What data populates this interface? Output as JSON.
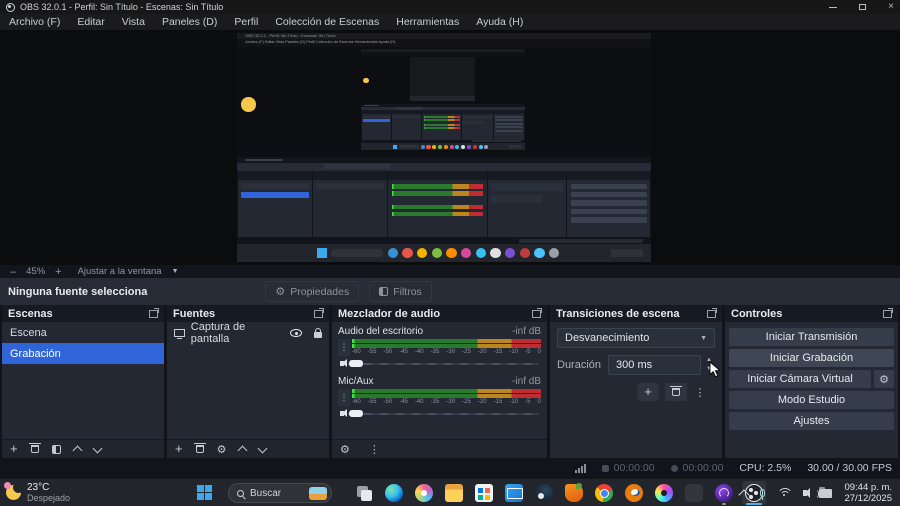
{
  "window": {
    "title": "OBS 32.0.1 - Perfil: Sin Título - Escenas: Sin Título"
  },
  "menu": {
    "items": [
      "Archivo (F)",
      "Editar",
      "Vista",
      "Paneles (D)",
      "Perfil",
      "Colección de Escenas",
      "Herramientas",
      "Ayuda (H)"
    ]
  },
  "preview_toolbar": {
    "minus": "–",
    "zoom_level": "45%",
    "plus": "+",
    "fit_label": "Ajustar a la ventana"
  },
  "source_row": {
    "status": "Ninguna fuente selecciona",
    "properties_label": "Propiedades",
    "filters_label": "Filtros"
  },
  "docks": {
    "scenes": {
      "title": "Escenas",
      "items": [
        {
          "label": "Escena",
          "selected": false
        },
        {
          "label": "Grabación",
          "selected": true
        }
      ]
    },
    "sources": {
      "title": "Fuentes",
      "items": [
        {
          "label": "Captura de pantalla",
          "icon": "display-capture-icon",
          "visible": true,
          "locked": false
        }
      ]
    },
    "mixer": {
      "title": "Mezclador de audio",
      "channels": [
        {
          "label": "Audio del escritorio",
          "level": "-inf dB"
        },
        {
          "label": "Mic/Aux",
          "level": "-inf dB"
        }
      ],
      "ticks": [
        "-60",
        "-55",
        "-50",
        "-45",
        "-40",
        "-35",
        "-30",
        "-25",
        "-20",
        "-15",
        "-10",
        "-5",
        "0"
      ]
    },
    "transitions": {
      "title": "Transiciones de escena",
      "transition": "Desvanecimiento",
      "duration_label": "Duración",
      "duration_value": "300 ms"
    },
    "controls": {
      "title": "Controles",
      "buttons": [
        "Iniciar Transmisión",
        "Iniciar Grabación",
        "Iniciar Cámara Virtual",
        "Modo Estudio",
        "Ajustes"
      ]
    }
  },
  "status_bar": {
    "stream_time": "00:00:00",
    "record_time": "00:00:00",
    "cpu": "CPU: 2.5%",
    "fps": "30.00 / 30.00 FPS"
  },
  "taskbar": {
    "weather_temp": "23°C",
    "weather_desc": "Despejado",
    "search_placeholder": "Buscar",
    "apps": [
      "taskview",
      "edge",
      "paint",
      "folder",
      "store",
      "mail",
      "steam",
      "carrot",
      "chrome",
      "blender",
      "colorwheel",
      "ghost",
      "affinity",
      "obs"
    ],
    "active_app": "obs",
    "running_apps": [
      "affinity",
      "obs"
    ],
    "time": "09:44 p. m.",
    "date": "27/12/2025"
  },
  "colors": {
    "accent_blue": "#2f65d9",
    "meter_green": "#2a7a2d",
    "meter_yellow": "#b9861f",
    "meter_red": "#bf2d32",
    "taskbar_underline": "#48b2e8",
    "mini_dots": [
      "#3a8fd6",
      "#e8554d",
      "#f4b400",
      "#7ac143",
      "#ff8c00",
      "#d44a9a",
      "#35c1f1",
      "#e0e0e0",
      "#7b4fd0",
      "#c03a3a",
      "#4cc2ff",
      "#9aa0a8"
    ]
  }
}
